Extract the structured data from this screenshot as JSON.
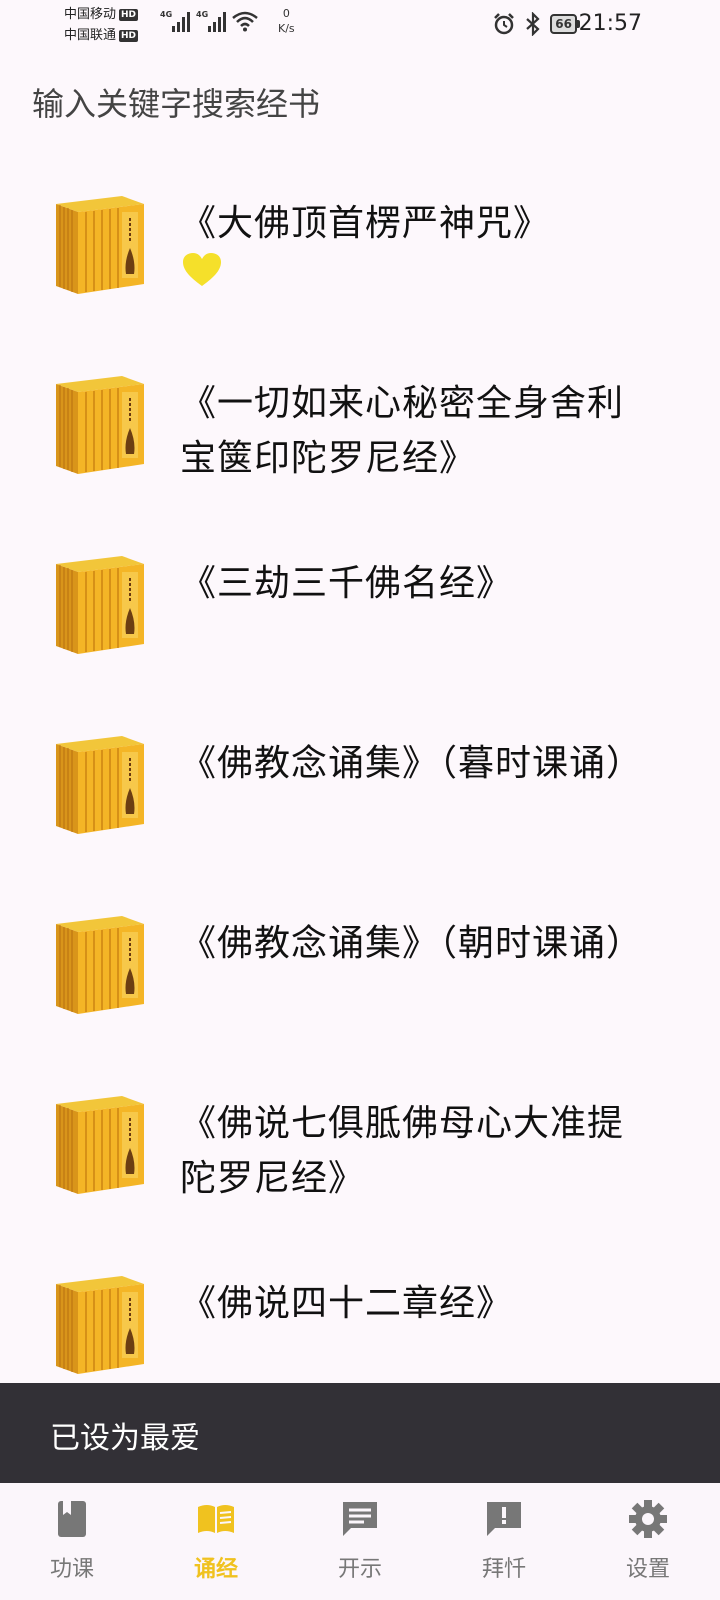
{
  "status_bar": {
    "carrier1": "中国移动",
    "carrier2": "中国联通",
    "hd": "HD",
    "network": "4G",
    "speed_value": "0",
    "speed_unit": "K/s",
    "battery": "66",
    "time": "21:57"
  },
  "search": {
    "placeholder": "输入关键字搜索经书"
  },
  "books": [
    {
      "title": "《大佛顶首楞严神咒》",
      "favorite": true
    },
    {
      "title": "《一切如来心秘密全身舍利宝箧印陀罗尼经》",
      "favorite": false
    },
    {
      "title": "《三劫三千佛名经》",
      "favorite": false
    },
    {
      "title": "《佛教念诵集》（暮时课诵）",
      "favorite": false
    },
    {
      "title": "《佛教念诵集》（朝时课诵）",
      "favorite": false
    },
    {
      "title": "《佛说七俱胝佛母心大准提陀罗尼经》",
      "favorite": false
    },
    {
      "title": "《佛说四十二章经》",
      "favorite": false
    }
  ],
  "snackbar": {
    "message": "已设为最爱"
  },
  "nav": {
    "items": [
      {
        "label": "功课",
        "icon": "book-bookmark-icon",
        "active": false
      },
      {
        "label": "诵经",
        "icon": "open-book-icon",
        "active": true
      },
      {
        "label": "开示",
        "icon": "message-icon",
        "active": false
      },
      {
        "label": "拜忏",
        "icon": "alert-message-icon",
        "active": false
      },
      {
        "label": "设置",
        "icon": "gear-icon",
        "active": false
      }
    ]
  },
  "colors": {
    "accent": "#f0c21f",
    "heart": "#f5e02a",
    "snackbar": "#323036",
    "nav_inactive": "#777777"
  }
}
